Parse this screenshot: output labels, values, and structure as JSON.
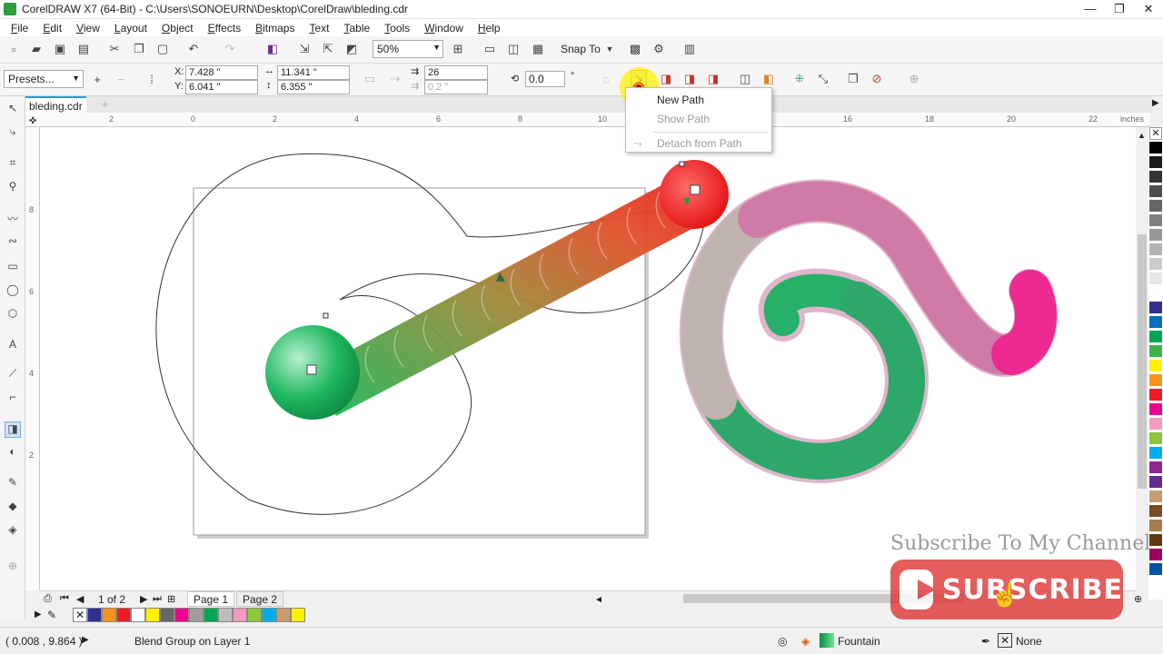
{
  "window": {
    "title": "CorelDRAW X7 (64-Bit) - C:\\Users\\SONOEURN\\Desktop\\CorelDraw\\bleding.cdr",
    "controls": [
      "—",
      "❐",
      "✕"
    ]
  },
  "menu": [
    "File",
    "Edit",
    "View",
    "Layout",
    "Object",
    "Effects",
    "Bitmaps",
    "Text",
    "Table",
    "Tools",
    "Window",
    "Help"
  ],
  "toolbar": {
    "zoom": "50%",
    "snap_label": "Snap To"
  },
  "propbar": {
    "presets": "Presets...",
    "x_label": "X:",
    "x": "7.428 \"",
    "y_label": "Y:",
    "y": "6.041 \"",
    "w": "11.341 \"",
    "h": "6.355 \"",
    "steps": "26",
    "offset": "0.2 \"",
    "angle": "0.0",
    "degree": "°"
  },
  "document": {
    "tab": "bleding.cdr"
  },
  "ruler": {
    "unit": "inches",
    "h_ticks": [
      "2",
      "0",
      "2",
      "4",
      "6",
      "8",
      "10",
      "16",
      "18",
      "20",
      "22"
    ],
    "v_ticks": [
      "8",
      "6",
      "4",
      "2"
    ]
  },
  "popup": {
    "items": [
      "New Path",
      "Show Path",
      "Detach from Path"
    ]
  },
  "pages": {
    "counter": "1 of 2",
    "tabs": [
      "Page 1",
      "Page 2"
    ]
  },
  "status": {
    "coords": "( 0.008 , 9.864 )",
    "info": "Blend Group on Layer 1",
    "fill": "Fountain",
    "outline": "None"
  },
  "overlay": {
    "subscribe_text": "Subscribe To My Channel",
    "button": "SUBSCRIBE"
  },
  "colors": {
    "palette": [
      "#000000",
      "#1a1a1a",
      "#333333",
      "#4d4d4d",
      "#666666",
      "#808080",
      "#999999",
      "#b3b3b3",
      "#cccccc",
      "#e6e6e6",
      "#ffffff",
      "#2e3192",
      "#0072bc",
      "#00a651",
      "#39b54a",
      "#fff200",
      "#f7941d",
      "#ed1c24",
      "#ec008c",
      "#f49ac1",
      "#8dc63f",
      "#00aeef",
      "#92278f",
      "#662d91",
      "#c69c6d",
      "#754c24",
      "#a67c52",
      "#603913",
      "#9e005d",
      "#0054a6"
    ],
    "doc_palette": [
      "#2e3192",
      "#f7941d",
      "#ed1c24",
      "#ffffff",
      "#fff200",
      "#666666",
      "#ec008c",
      "#9e9e9e",
      "#00a651",
      "#bdbdbd",
      "#f49ac1",
      "#8dc63f",
      "#00aeef",
      "#c69c6d",
      "#fff200"
    ]
  }
}
